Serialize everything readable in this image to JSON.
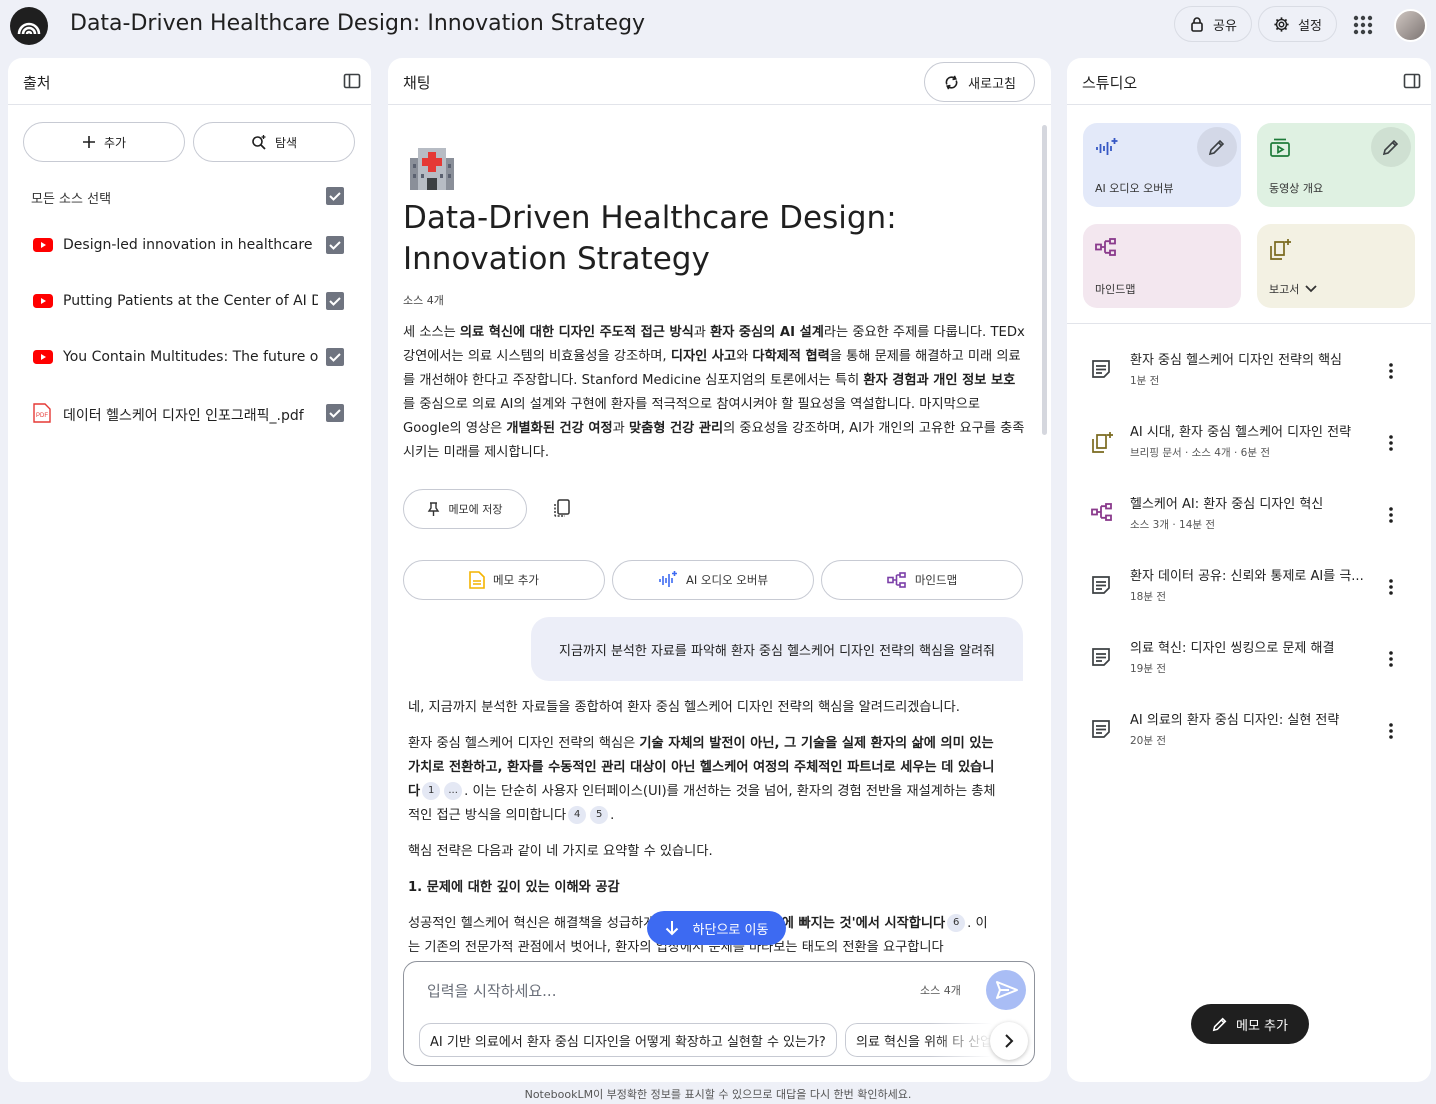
{
  "app": {
    "title": "Data-Driven Healthcare Design: Innovation Strategy"
  },
  "header": {
    "share_label": "공유",
    "settings_label": "설정"
  },
  "sources": {
    "title": "출처",
    "add_label": "추가",
    "explore_label": "탐색",
    "select_all_label": "모든 소스 선택",
    "items": [
      {
        "label": "Design-led innovation in healthcare | ...",
        "type": "youtube"
      },
      {
        "label": "Putting Patients at the Center of AI De...",
        "type": "youtube"
      },
      {
        "label": "You Contain Multitudes: The future of ...",
        "type": "youtube"
      },
      {
        "label": "데이터 헬스케어 디자인 인포그래픽_.pdf",
        "type": "pdf"
      }
    ]
  },
  "chat": {
    "title": "채팅",
    "refresh_label": "새로고침",
    "notebook_title": "Data-Driven Healthcare Design: Innovation Strategy",
    "source_count": "소스 4개",
    "summary_parts": [
      {
        "t": "세 소스는 "
      },
      {
        "t": "의료 혁신에 대한 디자인 주도적 접근 방식",
        "b": true
      },
      {
        "t": "과 "
      },
      {
        "t": "환자 중심의 AI 설계",
        "b": true
      },
      {
        "t": "라는 중요한 주제를 다룹니다. TEDx 강연에서는 의료 시스템의 비효율성을 강조하며, "
      },
      {
        "t": "디자인 사고",
        "b": true
      },
      {
        "t": "와 "
      },
      {
        "t": "다학제적 협력",
        "b": true
      },
      {
        "t": "을 통해 문제를 해결하고 미래 의료를 개선해야 한다고 주장합니다. Stanford Medicine 심포지엄의 토론에서는 특히 "
      },
      {
        "t": "환자 경험과 개인 정보 보호",
        "b": true
      },
      {
        "t": "를 중심으로 의료 AI의 설계와 구현에 환자를 적극적으로 참여시켜야 할 필요성을 역설합니다. 마지막으로 Google의 영상은 "
      },
      {
        "t": "개별화된 건강 여정",
        "b": true
      },
      {
        "t": "과 "
      },
      {
        "t": "맞춤형 건강 관리",
        "b": true
      },
      {
        "t": "의 중요성을 강조하며, AI가 개인의 고유한 요구를 충족시키는 미래를 제시합니다."
      }
    ],
    "save_memo_label": "메모에 저장",
    "actions": [
      "메모 추가",
      "AI 오디오 오버뷰",
      "마인드맵"
    ],
    "user_question": "지금까지 분석한 자료를 파악해 환자 중심 헬스케어 디자인 전략의 핵심을 알려줘",
    "answer": {
      "intro": "네, 지금까지 분석한 자료들을 종합하여 환자 중심 헬스케어 디자인 전략의 핵심을 알려드리겠습니다.",
      "p2_start": "환자 중심 헬스케어 디자인 전략의 핵심은 ",
      "p2_bold": "기술 자체의 발전이 아닌, 그 기술을 실제 환자의 삶에 의미 있는 가치로 전환하고, 환자를 수동적인 관리 대상이 아닌 헬스케어 여정의 주체적인 파트너로 세우는 데 있습니다",
      "p2_cite1": "1",
      "p2_cite2": "...",
      "p2_mid": ". 이는 단순히 사용자 인터페이스(UI)를 개선하는 것을 넘어, 환자의 경험 전반을 재설계하는 총체적인 접근 방식을 의미합니다",
      "p2_cite3": "4",
      "p2_cite4": "5",
      "p2_end": ".",
      "p3": "핵심 전략은 다음과 같이 네 가지로 요약할 수 있습니다.",
      "h1": "1. 문제에 대한 깊이 있는 이해와 공감",
      "p4_start": "성공적인 헬스케어 혁신은 해결책을 성급하게 ",
      "p4_bold": "사랑에 빠지는 것'에서 시작합니다",
      "p4_cite": "6",
      "p4_rest": ". 이는 기존의 전문가적 관점에서 벗어나, 환자의 입장에서 문제를 바라보는 태도의 전환을 요구합니다"
    },
    "scroll_down_label": "하단으로 이동",
    "input_placeholder": "입력을 시작하세요...",
    "input_source_count": "소스 4개",
    "suggestions": [
      "AI 기반 의료에서 환자 중심 디자인을 어떻게 확장하고 실현할 수 있는가?",
      "의료 혁신을 위해 타 산업"
    ]
  },
  "studio": {
    "title": "스튜디오",
    "cards": [
      {
        "label": "AI 오디오 오버뷰",
        "color": "#e3e9f9"
      },
      {
        "label": "동영상 개요",
        "color": "#dff1e2"
      },
      {
        "label": "마인드맵",
        "color": "#f3e7ef"
      },
      {
        "label": "보고서",
        "color": "#f3f1e3"
      }
    ],
    "notes": [
      {
        "title": "환자 중심 헬스케어 디자인 전략의 핵심",
        "sub": "1분 전",
        "icon": "note"
      },
      {
        "title": "AI 시대, 환자 중심 헬스케어 디자인 전략",
        "sub": "브리핑 문서 · 소스 4개 · 6분 전",
        "icon": "report"
      },
      {
        "title": "헬스케어 AI: 환자 중심 디자인 혁신",
        "sub": "소스 3개 · 14분 전",
        "icon": "mindmap"
      },
      {
        "title": "환자 데이터 공유: 신뢰와 통제로 AI를 극...",
        "sub": "18분 전",
        "icon": "note"
      },
      {
        "title": "의료 혁신: 디자인 씽킹으로 문제 해결",
        "sub": "19분 전",
        "icon": "note"
      },
      {
        "title": "AI 의료의 환자 중심 디자인: 실현 전략",
        "sub": "20분 전",
        "icon": "note"
      }
    ],
    "add_memo_label": "메모 추가"
  },
  "footer": {
    "disclaimer": "NotebookLM이 부정확한 정보를 표시할 수 있으므로 대답을 다시 한번 확인하세요."
  }
}
